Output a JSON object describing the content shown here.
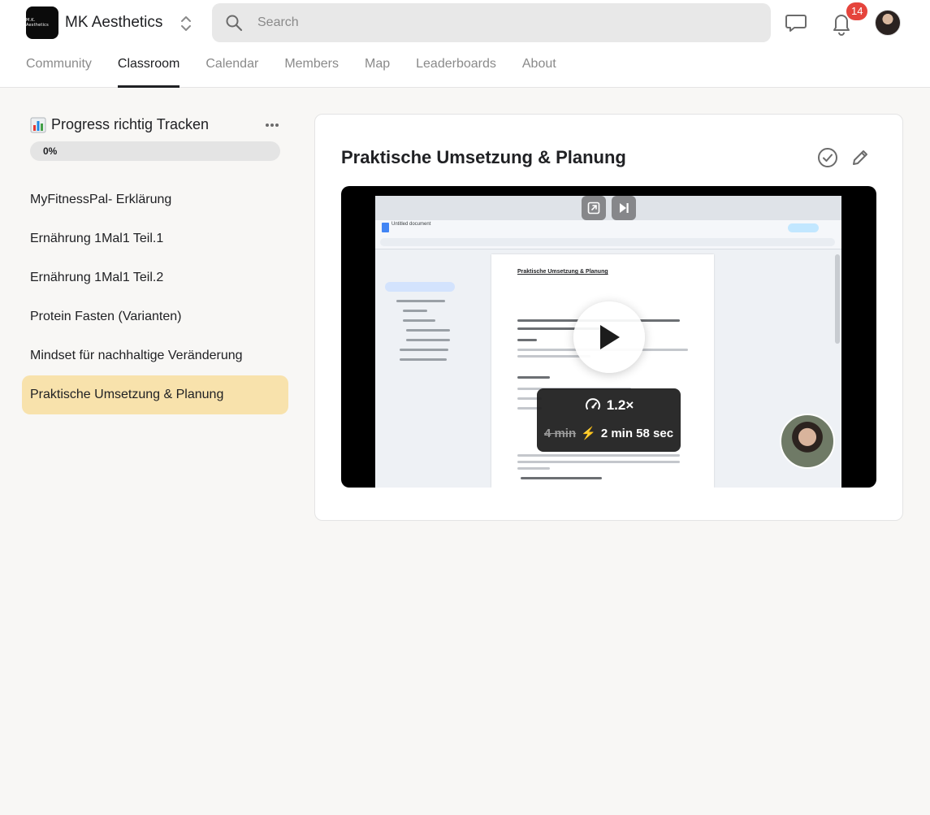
{
  "header": {
    "brand_name": "MK Aesthetics",
    "logo_text": "M.K. Aesthetics",
    "search_placeholder": "Search",
    "notifications_count": "14"
  },
  "tabs": [
    {
      "label": "Community",
      "active": false
    },
    {
      "label": "Classroom",
      "active": true
    },
    {
      "label": "Calendar",
      "active": false
    },
    {
      "label": "Members",
      "active": false
    },
    {
      "label": "Map",
      "active": false
    },
    {
      "label": "Leaderboards",
      "active": false
    },
    {
      "label": "About",
      "active": false
    }
  ],
  "sidebar": {
    "title_icon": "bar-chart-emoji",
    "title": "Progress richtig Tracken",
    "progress_label": "0%",
    "progress_value": 0,
    "lessons": [
      {
        "label": "MyFitnessPal- Erklärung",
        "active": false
      },
      {
        "label": "Ernährung 1Mal1 Teil.1",
        "active": false
      },
      {
        "label": "Ernährung 1Mal1 Teil.2",
        "active": false
      },
      {
        "label": "Protein Fasten (Varianten)",
        "active": false
      },
      {
        "label": "Mindset für nachhaltige Veränderung",
        "active": false
      },
      {
        "label": "Praktische Umsetzung & Planung",
        "active": true
      }
    ]
  },
  "content": {
    "title": "Praktische Umsetzung & Planung",
    "video": {
      "doc_title": "Untitled document",
      "doc_heading": "Praktische Umsetzung & Planung",
      "speed": "1.2×",
      "original_duration": "4 min",
      "new_duration": "2 min 58 sec"
    }
  },
  "colors": {
    "accent_active_lesson": "#f8e2ac",
    "badge": "#e5443c",
    "page_background": "#f8f7f5"
  }
}
